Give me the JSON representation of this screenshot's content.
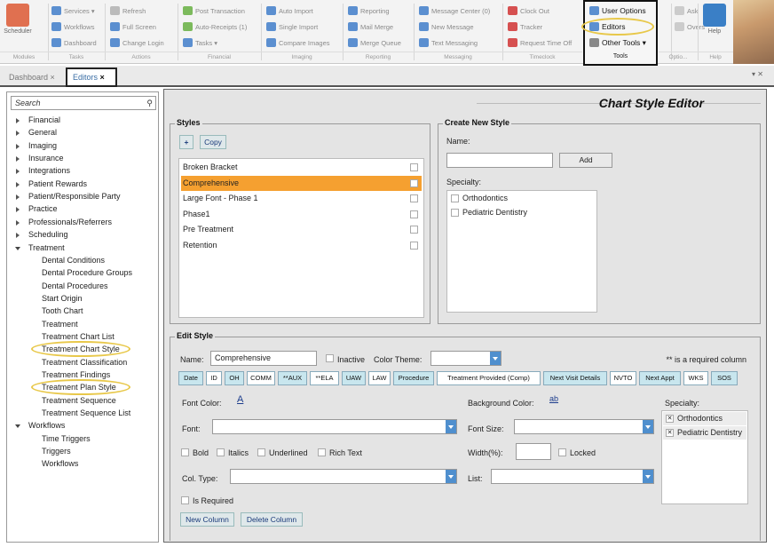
{
  "ribbon": {
    "scheduler": "Scheduler",
    "col1": [
      "Services ▾",
      "Workflows",
      "Dashboard"
    ],
    "col2": [
      "Refresh",
      "Full Screen",
      "Change Login"
    ],
    "col3": [
      "Post Transaction",
      "Auto-Receipts (1)",
      "Tasks ▾"
    ],
    "col4": [
      "Auto Import",
      "Single Import",
      "Compare Images"
    ],
    "col5": [
      "Reporting",
      "Mail Merge",
      "Merge Queue"
    ],
    "col6": [
      "Message Center (0)",
      "New Message",
      "Text Messaging"
    ],
    "col7": [
      "Clock Out",
      "Tracker",
      "Request Time Off"
    ],
    "tools": [
      "User Options",
      "Editors",
      "Other Tools ▾"
    ],
    "col9": [
      "Ask",
      "Overs"
    ],
    "help": "Help",
    "groups": [
      "Modules",
      "Tasks",
      "Actions",
      "Financial",
      "Imaging",
      "Reporting",
      "Messaging",
      "Timeclock",
      "Tools",
      "Optio...",
      "Help"
    ]
  },
  "tabs": {
    "dashboard": "Dashboard",
    "editors": "Editors"
  },
  "sidebar": {
    "search_placeholder": "Search",
    "items": [
      "Financial",
      "General",
      "Imaging",
      "Insurance",
      "Integrations",
      "Patient Rewards",
      "Patient/Responsible Party",
      "Practice",
      "Professionals/Referrers",
      "Scheduling",
      "Treatment"
    ],
    "treatment_children": [
      "Dental Conditions",
      "Dental Procedure Groups",
      "Dental Procedures",
      "Start Origin",
      "Tooth Chart",
      "Treatment",
      "Treatment Chart List",
      "Treatment Chart Style",
      "Treatment Classification",
      "Treatment Findings",
      "Treatment Plan Style",
      "Treatment Sequence",
      "Treatment Sequence List"
    ],
    "workflows": "Workflows",
    "workflows_children": [
      "Time Triggers",
      "Triggers",
      "Workflows"
    ]
  },
  "main": {
    "title": "Chart Style Editor",
    "styles_legend": "Styles",
    "copy": "Copy",
    "add_icon": "+",
    "styles": [
      "Broken Bracket",
      "Comprehensive",
      "Large Font - Phase 1",
      "Phase1",
      "Pre Treatment",
      "Retention"
    ],
    "create_legend": "Create New Style",
    "name_label": "Name:",
    "add": "Add",
    "specialty_label": "Specialty:",
    "specialties": [
      "Orthodontics",
      "Pediatric Dentistry"
    ],
    "edit_legend": "Edit Style",
    "edit_name_label": "Name:",
    "edit_name_value": "Comprehensive",
    "inactive": "Inactive",
    "color_theme": "Color Theme:",
    "required_note": "** is a required column",
    "columns": [
      "Date",
      "ID",
      "OH",
      "COMM",
      "**AUX",
      "**ELA",
      "UAW",
      "LAW",
      "Procedure",
      "Treatment Provided (Comp)",
      "Next Visit Details",
      "NVTO",
      "Next Appt",
      "WKS",
      "SOS"
    ],
    "font_color": "Font Color:",
    "bg_color": "Background Color:",
    "font": "Font:",
    "font_size": "Font Size:",
    "bold": "Bold",
    "italics": "Italics",
    "underlined": "Underlined",
    "rich_text": "Rich Text",
    "width": "Width(%):",
    "locked": "Locked",
    "col_type": "Col. Type:",
    "list": "List:",
    "is_required": "Is Required",
    "new_column": "New Column",
    "delete_column": "Delete Column",
    "edit_specialty": "Specialty:",
    "edit_specialties": [
      "Orthodontics",
      "Pediatric Dentistry"
    ],
    "check": "✕",
    "color_a": "A",
    "color_ab": "ab"
  }
}
